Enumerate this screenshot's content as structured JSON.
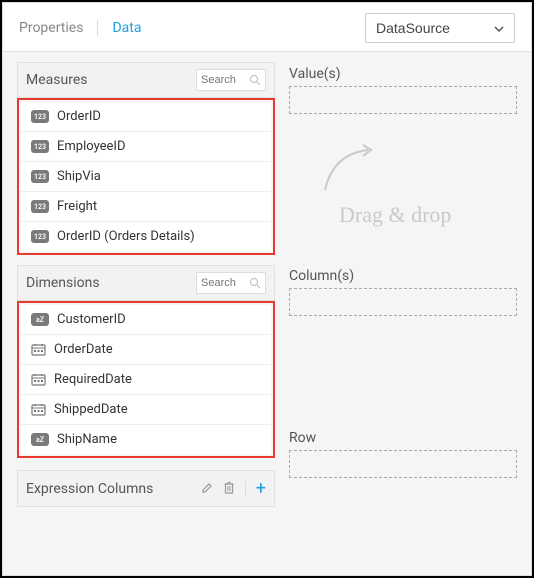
{
  "tabs": {
    "properties": "Properties",
    "data": "Data"
  },
  "datasource": {
    "selected": "DataSource"
  },
  "measures": {
    "title": "Measures",
    "search_placeholder": "Search",
    "items": [
      {
        "label": "OrderID",
        "icon": "num"
      },
      {
        "label": "EmployeeID",
        "icon": "num"
      },
      {
        "label": "ShipVia",
        "icon": "num"
      },
      {
        "label": "Freight",
        "icon": "num"
      },
      {
        "label": "OrderID (Orders Details)",
        "icon": "num"
      }
    ]
  },
  "dimensions": {
    "title": "Dimensions",
    "search_placeholder": "Search",
    "items": [
      {
        "label": "CustomerID",
        "icon": "txt"
      },
      {
        "label": "OrderDate",
        "icon": "cal"
      },
      {
        "label": "RequiredDate",
        "icon": "cal"
      },
      {
        "label": "ShippedDate",
        "icon": "cal"
      },
      {
        "label": "ShipName",
        "icon": "txt"
      }
    ]
  },
  "expression": {
    "title": "Expression Columns"
  },
  "zones": {
    "values": "Value(s)",
    "columns": "Column(s)",
    "row": "Row",
    "hint": "Drag & drop"
  },
  "icons": {
    "num_badge": "123",
    "txt_badge": "aZ",
    "plus": "+"
  }
}
